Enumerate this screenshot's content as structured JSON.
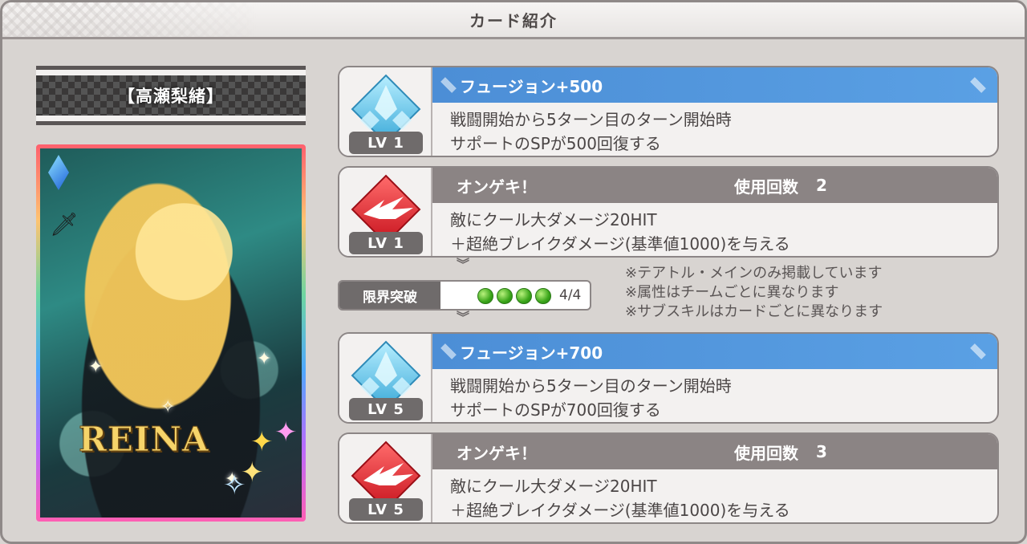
{
  "header": {
    "title": "カード紹介"
  },
  "character": {
    "name": "【高瀬梨緒】",
    "card_name": "REINA"
  },
  "skills": [
    {
      "level": "LV 1",
      "title": "フュージョン+500",
      "type": "fusion",
      "desc_line1": "戦闘開始から5ターン目のターン開始時",
      "desc_line2": "サポートのSPが500回復する"
    },
    {
      "level": "LV 1",
      "title": "オンゲキ！",
      "type": "ongeki",
      "uses_label": "使用回数",
      "uses_value": "2",
      "desc_line1": "敵にクール大ダメージ20HIT",
      "desc_line2": "＋超絶ブレイクダメージ(基準値1000)を与える"
    },
    {
      "level": "LV 5",
      "title": "フュージョン+700",
      "type": "fusion",
      "desc_line1": "戦闘開始から5ターン目のターン開始時",
      "desc_line2": "サポートのSPが700回復する"
    },
    {
      "level": "LV 5",
      "title": "オンゲキ！",
      "type": "ongeki",
      "uses_label": "使用回数",
      "uses_value": "3",
      "desc_line1": "敵にクール大ダメージ20HIT",
      "desc_line2": "＋超絶ブレイクダメージ(基準値1000)を与える"
    }
  ],
  "limit_break": {
    "label": "限界突破",
    "count": "4/4",
    "filled": 4,
    "total": 4
  },
  "notes": [
    "※テアトル・メインのみ掲載しています",
    "※属性はチームごとに異なります",
    "※サブスキルはカードごとに異なります"
  ],
  "colors": {
    "fusion_title": "#4c8ed6",
    "ongeki_title": "#8b8484",
    "accent_green": "#3aa51a"
  },
  "icons": {
    "fusion": "blue-crystal-icon",
    "ongeki": "red-burst-icon",
    "chevron": "double-chevron-down-icon"
  }
}
